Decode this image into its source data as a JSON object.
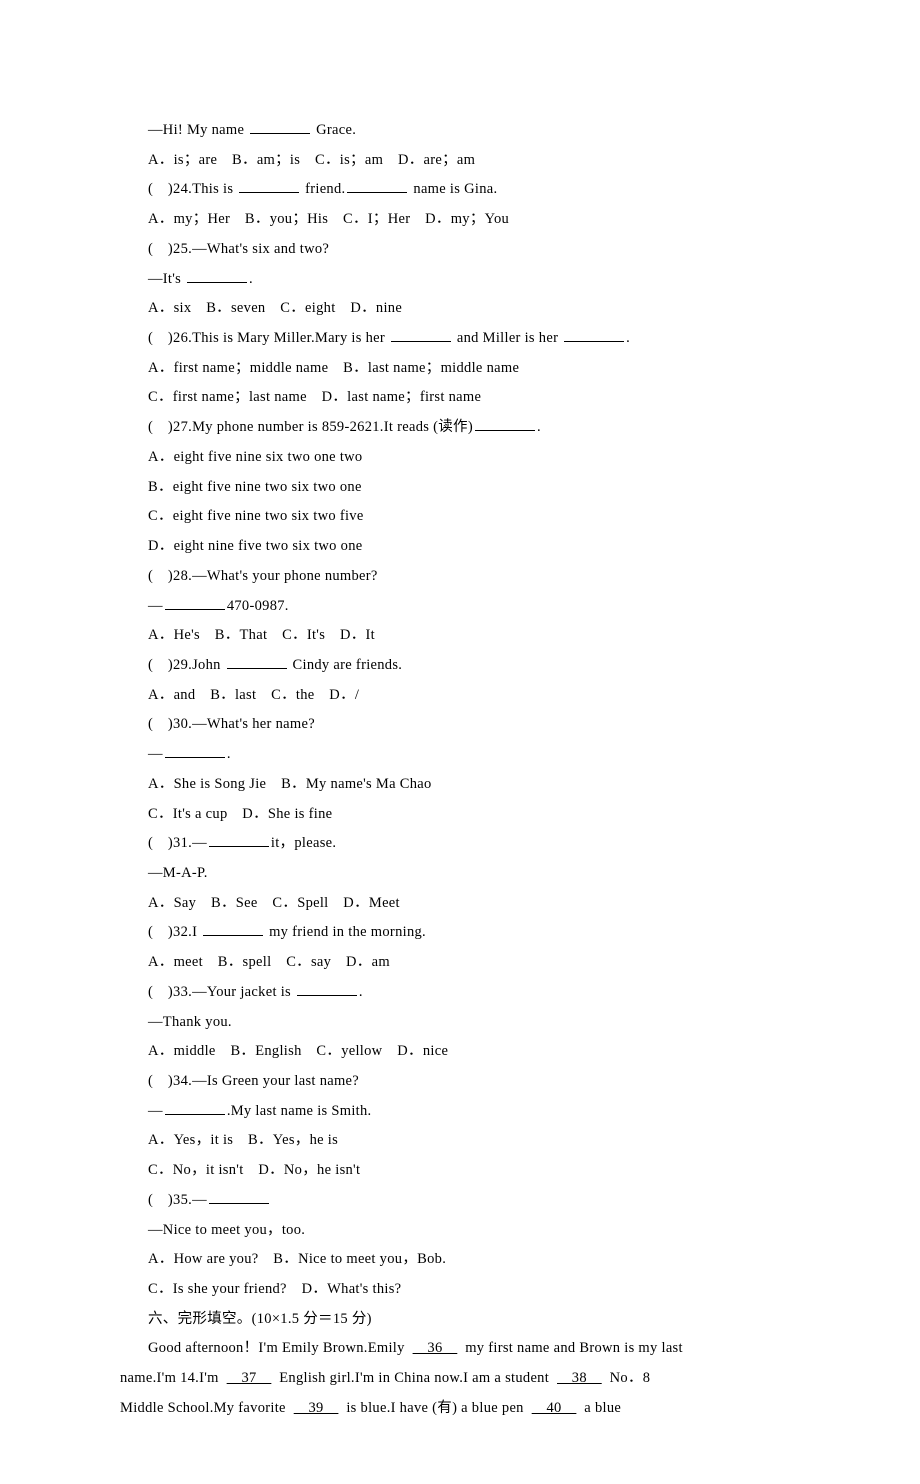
{
  "lines": {
    "l01": "—Hi! My name ",
    "l01b": " Grace.",
    "l02": "A．is；are　B．am；is　C．is；am　D．are；am",
    "l03a": "(　)24.This is ",
    "l03b": " friend.",
    "l03c": " name is Gina.",
    "l04": "A．my；Her　B．you；His　C．I；Her　D．my；You",
    "l05": "(　)25.—What's six and two?",
    "l06a": "—It's ",
    "l06b": ".",
    "l07": "A．six　B．seven　C．eight　D．nine",
    "l08a": "(　)26.This is Mary Miller.Mary is her ",
    "l08b": " and Miller is her ",
    "l08c": ".",
    "l09": "A．first name；middle name　B．last name；middle name",
    "l10": "C．first name；last name　D．last name；first name",
    "l11a": "(　)27.My phone number is 859-2621.It reads (读作)",
    "l11b": ".",
    "l12": "A．eight five nine six two one two",
    "l13": "B．eight five nine two six two one",
    "l14": "C．eight five nine two six two five",
    "l15": "D．eight nine five two six two one",
    "l16": "(　)28.—What's your phone number?",
    "l17a": "—",
    "l17b": "470-0987.",
    "l18": "A．He's　B．That　C．It's　D．It",
    "l19a": "(　)29.John ",
    "l19b": " Cindy are friends.",
    "l20": "A．and　B．last　C．the　D．/",
    "l21": "(　)30.—What's her name?",
    "l22a": "—",
    "l22b": ".",
    "l23": "A．She is Song Jie　B．My name's Ma Chao",
    "l24": "C．It's a cup　D．She is fine",
    "l25a": "(　)31.—",
    "l25b": "it，please.",
    "l26": "—M-A-P.",
    "l27": "A．Say　B．See　C．Spell　D．Meet",
    "l28a": "(　)32.I ",
    "l28b": " my friend in the morning.",
    "l29": "A．meet　B．spell　C．say　D．am",
    "l30a": "(　)33.—Your jacket is ",
    "l30b": ".",
    "l31": "—Thank you.",
    "l32": "A．middle　B．English　C．yellow　D．nice",
    "l33": "(　)34.—Is Green your last name?",
    "l34a": "—",
    "l34b": ".My last name is Smith.",
    "l35": "A．Yes，it is　B．Yes，he is",
    "l36": "C．No，it isn't　D．No，he isn't",
    "l37a": "(　)35.—",
    "l38": "—Nice to meet you，too.",
    "l39": "A．How are you?　B．Nice to meet you，Bob.",
    "l40": "C．Is she your friend?　D．What's this?",
    "l41": "六、完形填空。(10×1.5 分＝15 分)",
    "p1a": "Good afternoon！I'm Emily Brown.Emily ",
    "p1n36": "　36　",
    "p1b": " my first name and Brown is my last",
    "p2a": "name.I'm 14.I'm ",
    "p2n37": "　37　",
    "p2b": " English girl.I'm in China now.I am a student ",
    "p2n38": "　38　",
    "p2c": " No．8",
    "p3a": "Middle School.My favorite ",
    "p3n39": "　39　",
    "p3b": " is blue.I have (有) a blue pen ",
    "p3n40": "　40　",
    "p3c": " a blue"
  }
}
